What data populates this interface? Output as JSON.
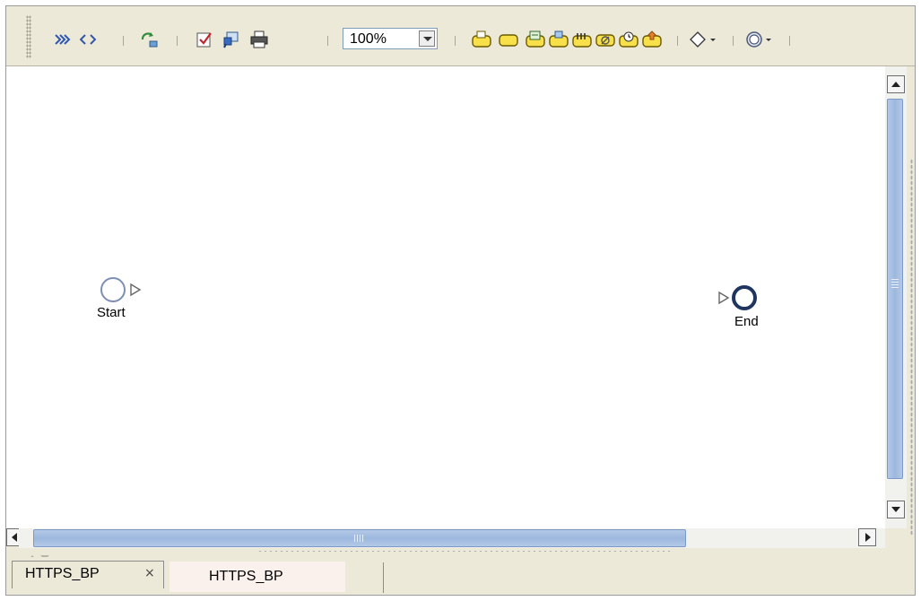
{
  "toolbar": {
    "zoom_value": "100%",
    "icons": [
      "bpel-icon",
      "source-code-icon",
      "synchronize-icon",
      "validate-icon",
      "search-icon",
      "print-icon",
      "receive-icon",
      "empty-activity-icon",
      "assign-icon",
      "invoke-icon",
      "while-icon",
      "throw-icon",
      "wait-icon",
      "reply-icon",
      "decision-icon",
      "event-icon"
    ]
  },
  "diagram": {
    "start_label": "Start",
    "end_label": "End"
  },
  "tabs": [
    {
      "label": "HTTPS_BP",
      "close": "×"
    },
    {
      "label": "HTTPS_BP"
    }
  ],
  "colors": {
    "chrome": "#ece9d8",
    "scroll_thumb": "#9cb8de",
    "start_stroke": "#7d8fb5",
    "end_stroke": "#1f3560"
  }
}
